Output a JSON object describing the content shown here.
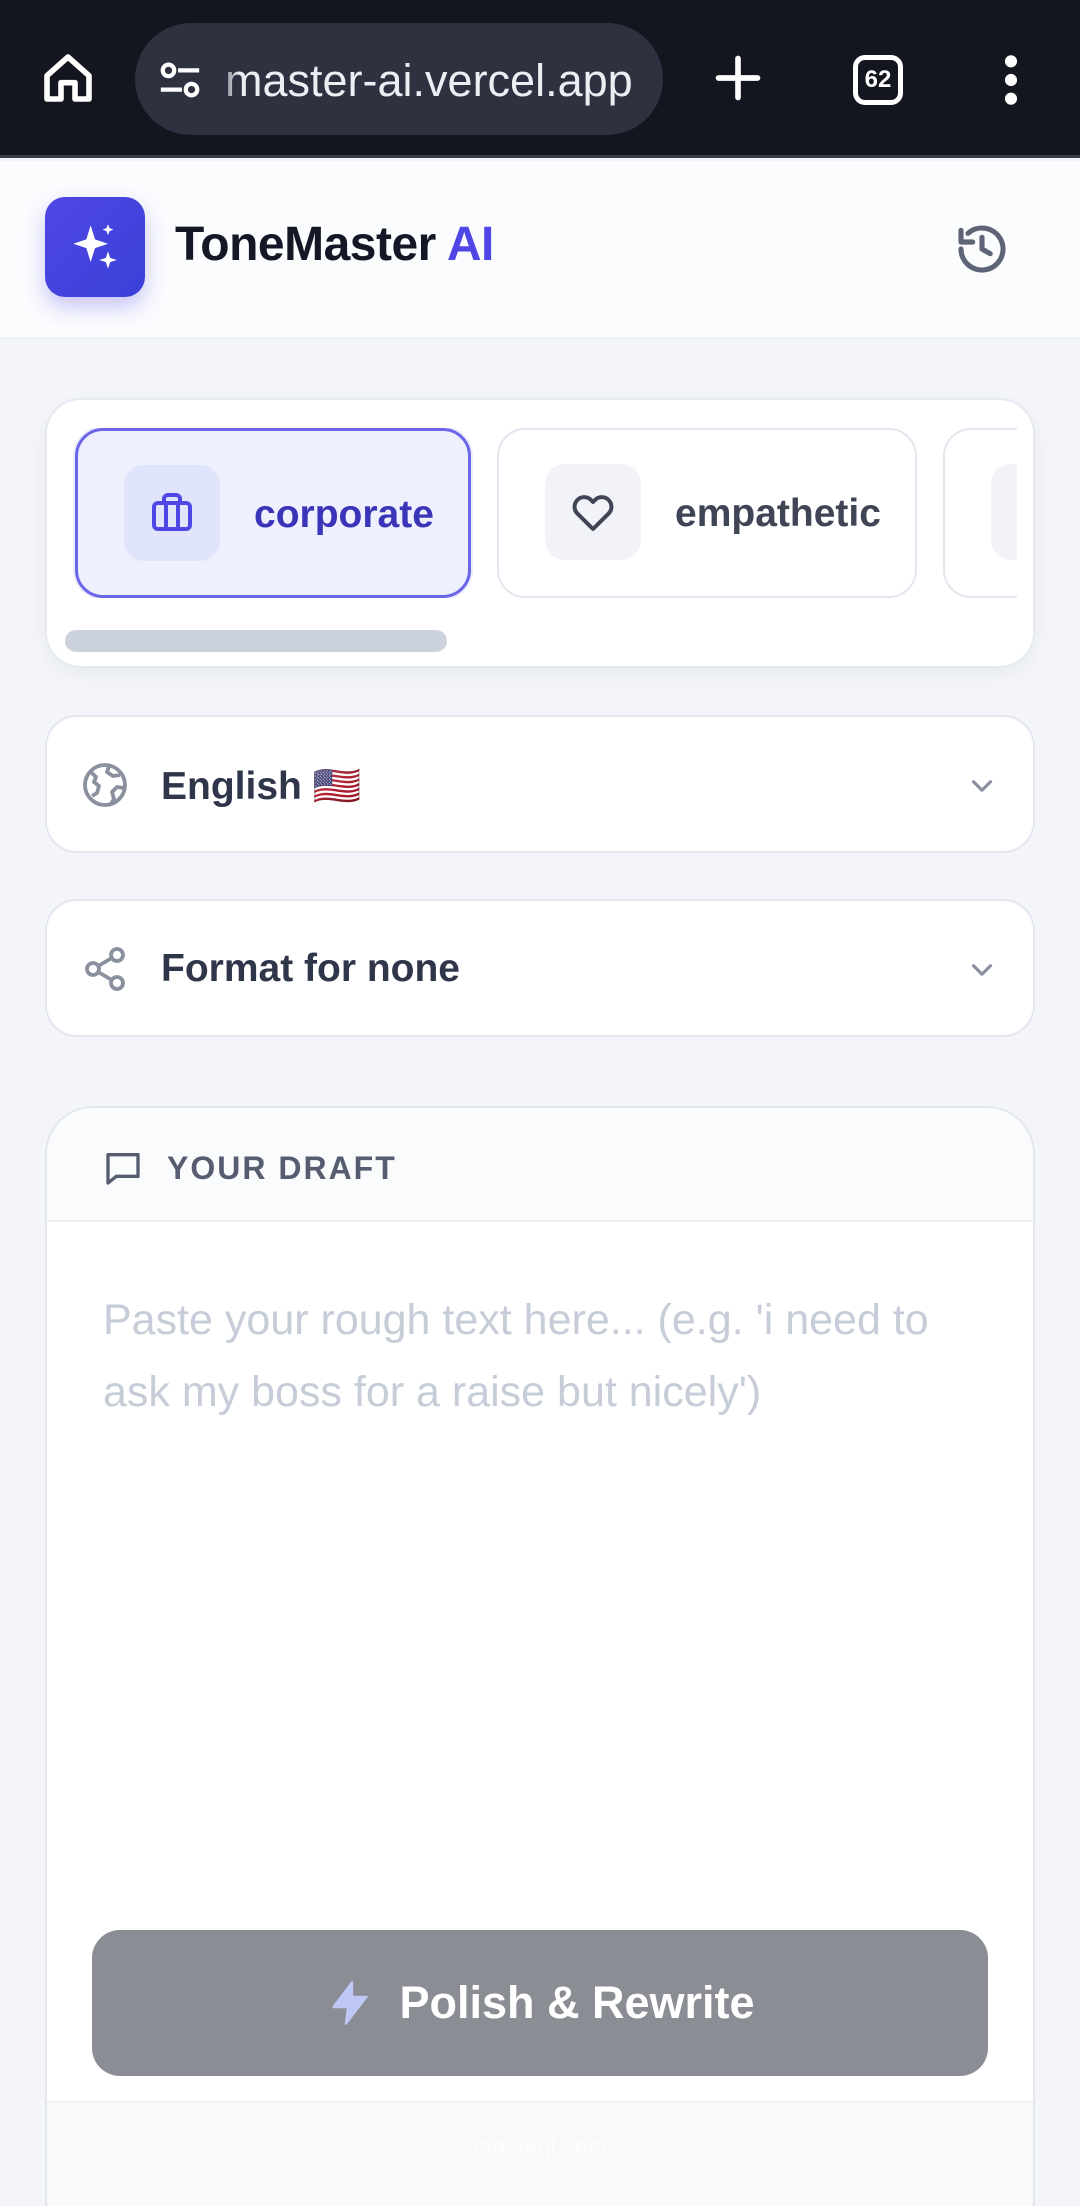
{
  "browser": {
    "url": "master-ai.vercel.app",
    "tab_count": "62"
  },
  "header": {
    "brand_main": "ToneMaster",
    "brand_accent": "AI",
    "accent_color": "#4f46e5"
  },
  "tones": [
    {
      "label": "corporate",
      "icon": "briefcase-icon",
      "selected": true
    },
    {
      "label": "empathetic",
      "icon": "heart-icon",
      "selected": false
    }
  ],
  "language_select": {
    "value": "English 🇺🇸",
    "icon": "globe-icon"
  },
  "format_select": {
    "value": "Format for none",
    "icon": "share-icon"
  },
  "draft": {
    "title": "YOUR DRAFT",
    "placeholder": "Paste your rough text here... (e.g. 'i need to ask my boss for a raise but nicely')",
    "value": ""
  },
  "action": {
    "label": "Polish & Rewrite"
  },
  "watermark": "mostaql.com"
}
